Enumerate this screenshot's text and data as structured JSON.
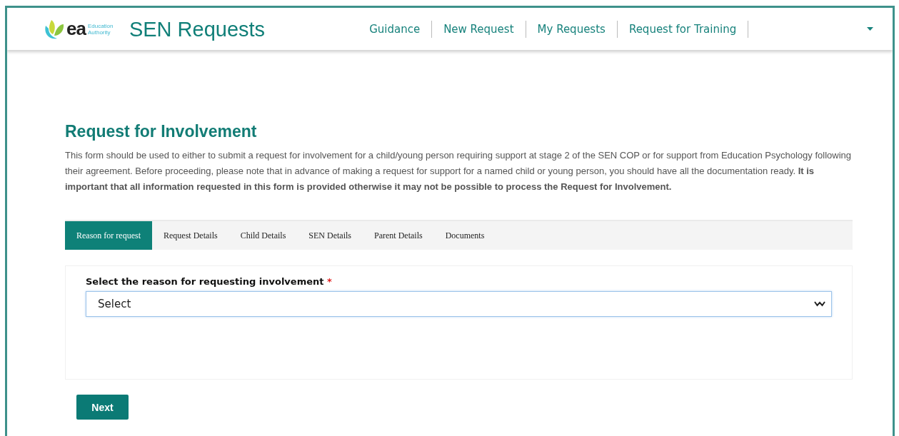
{
  "header": {
    "logo_text": "ea",
    "logo_subtext": "Education Authority",
    "app_title": "SEN Requests",
    "nav": [
      "Guidance",
      "New Request",
      "My Requests",
      "Request for Training"
    ]
  },
  "page": {
    "title": "Request for Involvement",
    "intro": "This form should be used to either to submit a request for involvement for a child/young person requiring support at stage 2 of the SEN COP or for support from Education Psychology following their agreement. Before proceeding, please note that in advance of making a request for support for a named child or young person, you should have all the documentation ready. **It is important that all information requested in this form is provided otherwise it may not be possible to process the Request for Involvement.**"
  },
  "tabs": [
    {
      "label": "Reason for request",
      "selected": true
    },
    {
      "label": "Request Details",
      "selected": false
    },
    {
      "label": "Child Details",
      "selected": false
    },
    {
      "label": "SEN Details",
      "selected": false
    },
    {
      "label": "Parent Details",
      "selected": false
    },
    {
      "label": "Documents",
      "selected": false
    }
  ],
  "form": {
    "label": "Select the reason for requesting involvement",
    "required_mark": "*",
    "select_value": "Select"
  },
  "buttons": [
    "Next"
  ]
}
